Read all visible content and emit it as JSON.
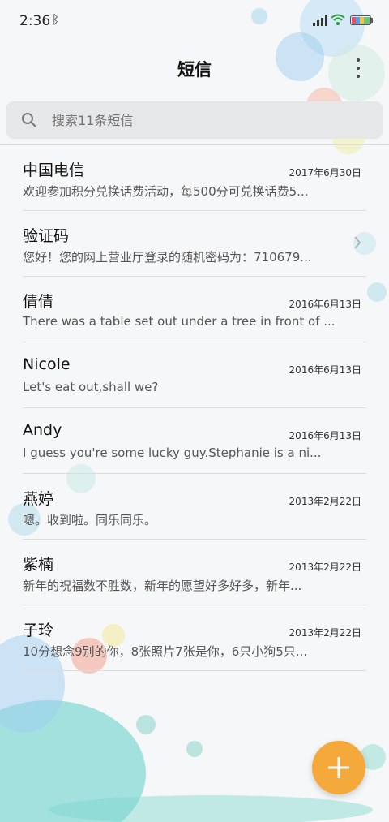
{
  "status": {
    "time": "2:36"
  },
  "header": {
    "title": "短信"
  },
  "search": {
    "placeholder": "搜索11条短信"
  },
  "messages": [
    {
      "name": "中国电信",
      "date": "2017年6月30日",
      "preview": "欢迎参加积分兑换话费活动，每500分可兑换话费5..."
    },
    {
      "name": "验证码",
      "date": "",
      "preview": "您好！您的网上营业厅登录的随机密码为：710679..."
    },
    {
      "name": "倩倩",
      "date": "2016年6月13日",
      "preview": "There was a table set out under a tree in front of ..."
    },
    {
      "name": "Nicole",
      "date": "2016年6月13日",
      "preview": "Let's eat out,shall we?"
    },
    {
      "name": "Andy",
      "date": "2016年6月13日",
      "preview": "I guess you're some lucky guy.Stephanie is a ni..."
    },
    {
      "name": "燕婷",
      "date": "2013年2月22日",
      "preview": "嗯。收到啦。同乐同乐。"
    },
    {
      "name": "紫楠",
      "date": "2013年2月22日",
      "preview": "新年的祝福数不胜数，新年的愿望好多好多，新年..."
    },
    {
      "name": "子玲",
      "date": "2013年2月22日",
      "preview": "10分想念9别的你，8张照片7张是你，6只小狗5只..."
    }
  ],
  "colors": {
    "accent": "#f5a93a",
    "background": "#f6f7f8"
  }
}
